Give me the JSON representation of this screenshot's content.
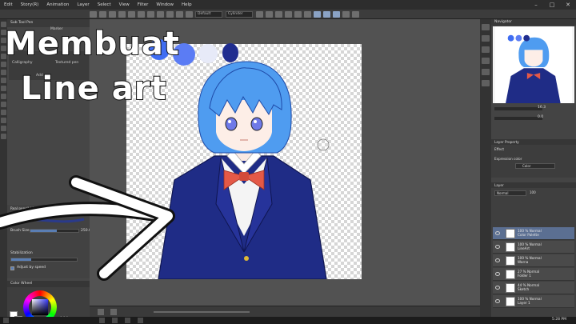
{
  "menubar": {
    "items": [
      "Edit",
      "Story(R)",
      "Animation",
      "Layer",
      "Select",
      "View",
      "Filter",
      "Window",
      "Help"
    ],
    "window_controls": [
      "–",
      "□",
      "✕"
    ]
  },
  "toolbar": {
    "select1": "Default",
    "select2": "Cylinder"
  },
  "left_panel": {
    "subtool_header": "Sub Tool Pen",
    "subtool_label": "Marker",
    "brush_names": [
      "Calligraphy",
      "Textured pen"
    ],
    "add_label": "Add",
    "props_header": "Real pencil / G pen",
    "brush_size_label": "Brush Size",
    "brush_size_value": "250.0",
    "brush_size_fraction": 0.55,
    "stabilization_label": "Stabilization",
    "adjust_label": "Adjust by speed",
    "color_wheel_header": "Color Wheel",
    "color_readout": "0 0 0"
  },
  "right_panel": {
    "navigator_header": "Navigator",
    "nav_zoom": "16.3",
    "nav_angle": "0.0",
    "layer_property_header": "Layer Property",
    "effect_label": "Effect",
    "expression_color_label": "Expression color",
    "expression_color_value": "Color",
    "layer_header": "Layer",
    "blend_mode": "Normal",
    "opacity": "100",
    "layers": [
      {
        "title": "100 % Normal",
        "name": "Color Palette",
        "selected": true
      },
      {
        "title": "100 % Normal",
        "name": "LineArt",
        "selected": false
      },
      {
        "title": "100 % Normal",
        "name": "Warna",
        "selected": false
      },
      {
        "title": "27 % Normal",
        "name": "Folder 1",
        "selected": false
      },
      {
        "title": "44 % Normal",
        "name": "Sketch",
        "selected": false
      },
      {
        "title": "100 % Normal",
        "name": "Layer 1",
        "selected": false
      }
    ]
  },
  "overlay": {
    "line1": "Membuat",
    "line2": "Line art"
  },
  "palette_colors": [
    "#3f6df2",
    "#5b7cf4",
    "#e7eaf8",
    "#202d8f"
  ],
  "taskbar": {
    "clock": "5:28 PM"
  },
  "colors": {
    "hair": "#4f9cf0",
    "jacket": "#1f2c86",
    "ribbon": "#e45947"
  }
}
